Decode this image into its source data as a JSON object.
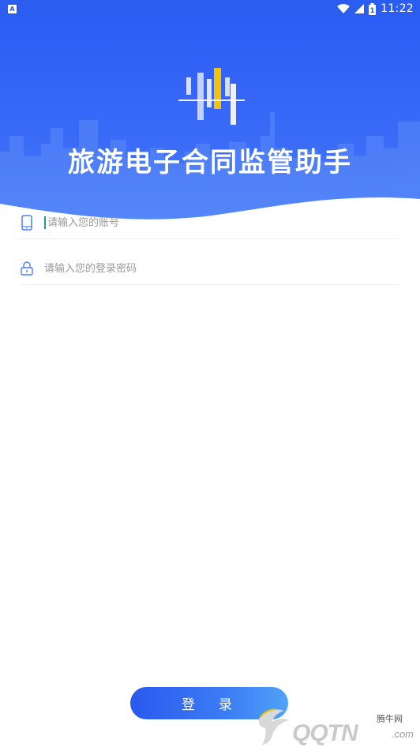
{
  "status_bar": {
    "notification_icon": "A",
    "icons": [
      "wifi-icon",
      "signal-icon",
      "battery-icon"
    ],
    "battery_glyph": "1",
    "time": "11:22"
  },
  "header": {
    "title": "旅游电子合同监管助手",
    "logo_icon": "bar-logo-icon",
    "background_color": "#2d5cf6",
    "accent_color": "#f5c400"
  },
  "form": {
    "username": {
      "icon": "phone-icon",
      "placeholder": "请输入您的账号",
      "value": ""
    },
    "password": {
      "icon": "lock-icon",
      "placeholder": "请输入您的登录密码",
      "value": ""
    }
  },
  "login_button": {
    "label": "登录",
    "color": "#2a59ee"
  },
  "watermark": {
    "text": "QQTN",
    "domain": ".com",
    "cn": "腾牛网"
  }
}
